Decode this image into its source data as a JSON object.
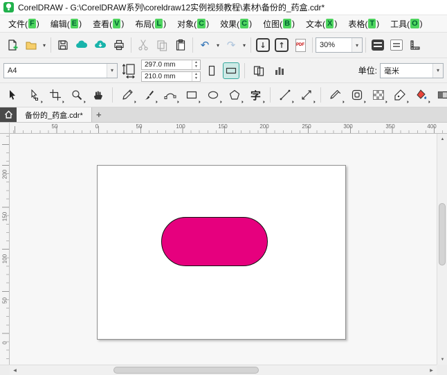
{
  "colors": {
    "accent_green": "#21b14c",
    "teal": "#18b3aa",
    "shape_fill": "#e6007e",
    "menu_accel_bg": "#4fd45f"
  },
  "title_bar": {
    "app_title": "CorelDRAW - G:\\CorelDRAW系列\\coreldraw12实例视频教程\\素材\\备份的_药盒.cdr*"
  },
  "menu": {
    "items": [
      {
        "pre": "文件(",
        "key": "F",
        "post": ")"
      },
      {
        "pre": "编辑(",
        "key": "E",
        "post": ")"
      },
      {
        "pre": "查看(",
        "key": "V",
        "post": ")"
      },
      {
        "pre": "布局(",
        "key": "L",
        "post": ")"
      },
      {
        "pre": "对象(",
        "key": "C",
        "post": ")"
      },
      {
        "pre": "效果(",
        "key": "C",
        "post": ")"
      },
      {
        "pre": "位图(",
        "key": "B",
        "post": ")"
      },
      {
        "pre": "文本(",
        "key": "X",
        "post": ")"
      },
      {
        "pre": "表格(",
        "key": "T",
        "post": ")"
      },
      {
        "pre": "工具(",
        "key": "O",
        "post": ")"
      }
    ]
  },
  "standard_toolbar": {
    "zoom_value": "30%",
    "pdf_label": "PDF"
  },
  "property_bar": {
    "page_preset": "A4",
    "page_width": "297.0 mm",
    "page_height": "210.0 mm",
    "units_label": "单位:",
    "units_value": "毫米"
  },
  "toolbox": {
    "text_tool_label": "字"
  },
  "doc_tabs": {
    "active_tab": "备份的_药盒.cdr*",
    "new_tab_label": "+"
  },
  "rulers": {
    "h_labels": [
      "50",
      "0",
      "50",
      "100",
      "150",
      "200",
      "250",
      "300",
      "350",
      "400"
    ],
    "v_labels": [
      "200",
      "150",
      "100",
      "50",
      "0"
    ]
  },
  "canvas": {
    "shape_fill": "#e6007e"
  },
  "icons": {
    "caret_down": "▾",
    "spin_up": "▲",
    "spin_down": "▼",
    "undo": "↶",
    "redo": "↷",
    "import_arrow": "↓",
    "export_arrow": "↑",
    "scroll_up": "▲",
    "scroll_down": "▼",
    "scroll_left": "◀",
    "scroll_right": "▶"
  }
}
